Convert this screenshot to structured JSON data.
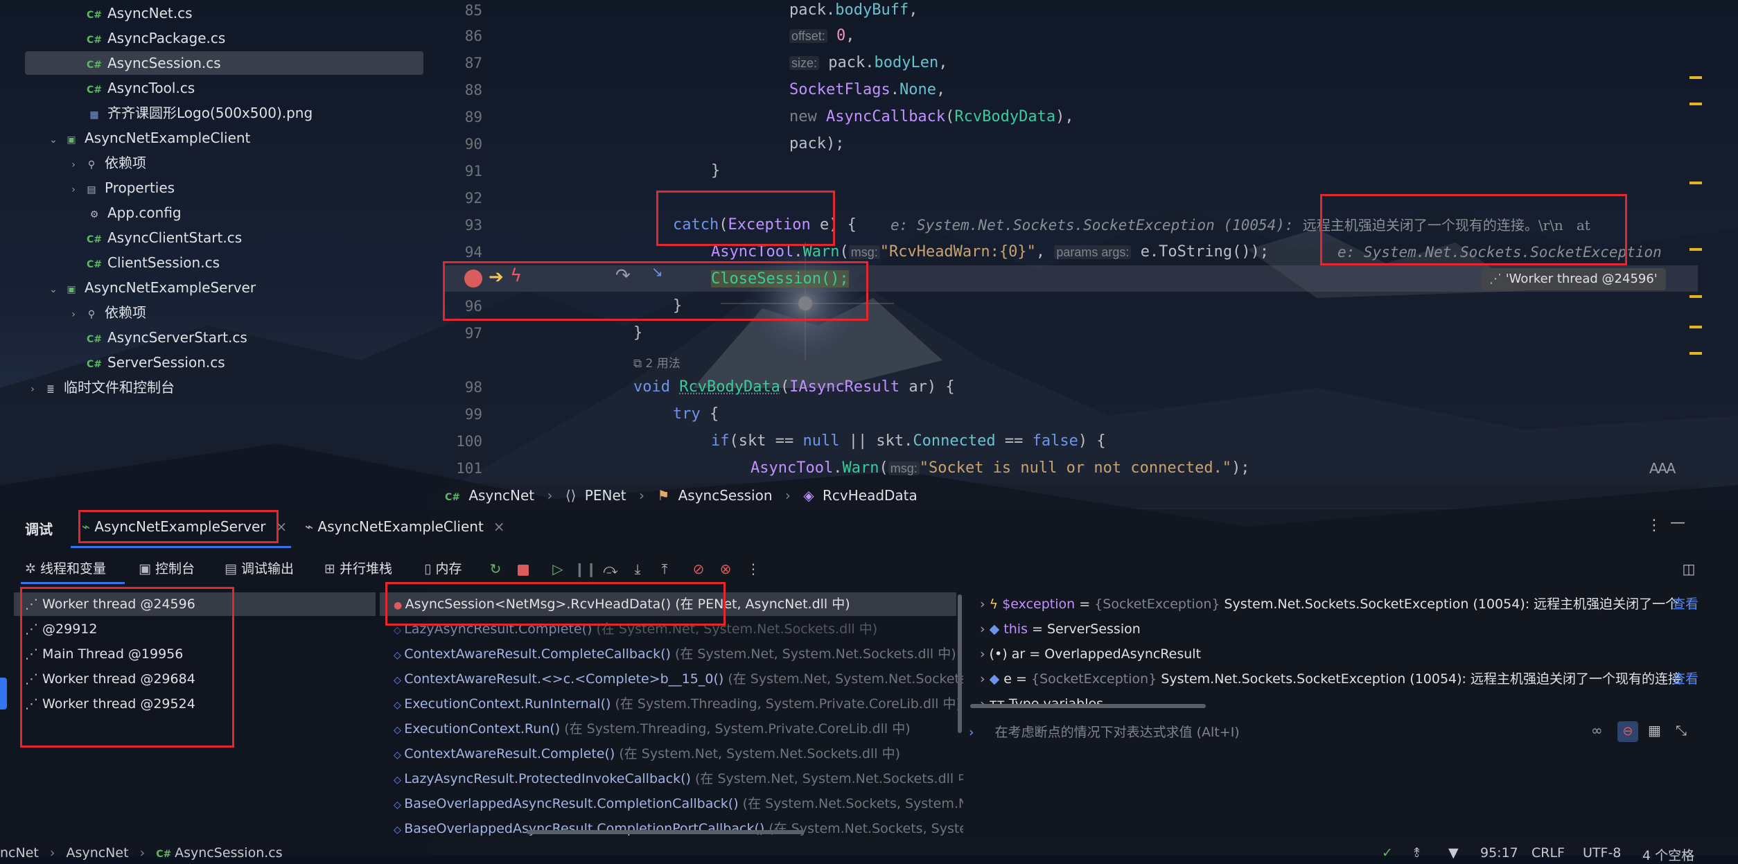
{
  "tree": {
    "items": [
      {
        "label": "AsyncNet.cs",
        "icon": "csharp-file-icon"
      },
      {
        "label": "AsyncPackage.cs",
        "icon": "csharp-file-icon"
      },
      {
        "label": "AsyncSession.cs",
        "icon": "csharp-file-icon"
      },
      {
        "label": "AsyncTool.cs",
        "icon": "csharp-file-icon"
      },
      {
        "label": "齐齐课圆形Logo(500x500).png",
        "icon": "image-file-icon"
      },
      {
        "label": "AsyncNetExampleClient",
        "icon": "csharp-project-icon"
      },
      {
        "label": "依赖项",
        "icon": "dependencies-icon"
      },
      {
        "label": "Properties",
        "icon": "properties-folder-icon"
      },
      {
        "label": "App.config",
        "icon": "config-file-icon"
      },
      {
        "label": "AsyncClientStart.cs",
        "icon": "csharp-file-icon"
      },
      {
        "label": "ClientSession.cs",
        "icon": "csharp-file-icon"
      },
      {
        "label": "AsyncNetExampleServer",
        "icon": "csharp-project-icon"
      },
      {
        "label": "依赖项",
        "icon": "dependencies-icon"
      },
      {
        "label": "AsyncServerStart.cs",
        "icon": "csharp-file-icon"
      },
      {
        "label": "ServerSession.cs",
        "icon": "csharp-file-icon"
      },
      {
        "label": "临时文件和控制台",
        "icon": "scratches-icon"
      }
    ],
    "cs_badge": "C#"
  },
  "editor": {
    "line_numbers": [
      "85",
      "86",
      "87",
      "88",
      "89",
      "90",
      "91",
      "92",
      "93",
      "94",
      "95",
      "96",
      "97",
      "98",
      "99",
      "100",
      "101"
    ],
    "lines": {
      "l85_obj": "pack.",
      "l85_prop": "bodyBuff",
      "l85_end": ",",
      "l86_hint": "offset:",
      "l86_val": "0",
      "l86_end": ",",
      "l87_hint": "size:",
      "l87_obj": "pack.",
      "l87_prop": "bodyLen",
      "l87_end": ",",
      "l88_type": "SocketFlags",
      "l88_dot": ".",
      "l88_enum": "None",
      "l88_end": ",",
      "l89_new": "new ",
      "l89_type": "AsyncCallback",
      "l89_open": "(",
      "l89_fn": "RcvBodyData",
      "l89_end": "),",
      "l90": "pack);",
      "l91": "}",
      "l93_kw": "catch",
      "l93_open": "(",
      "l93_type": "Exception",
      "l93_var": " e) {",
      "l93_inline": "e: System.Net.Sockets.SocketException (10054):",
      "l93_inline2": "远程主机强迫关闭了一个现有的连接。\\r\\n   at",
      "l94_cls": "AsyncTool",
      "l94_dot": ".",
      "l94_meth": "Warn",
      "l94_open": "(",
      "l94_hint1": "msg:",
      "l94_str": "\"RcvHeadWarn:{0}\"",
      "l94_comma": ", ",
      "l94_hint2": "params args:",
      "l94_rest": "e.ToString());",
      "l94_inline": "e: System.Net.Sockets.SocketException",
      "l95": "CloseSession();",
      "l96": "}",
      "l97": "}",
      "usages": "2 用法",
      "l98_kw": "void ",
      "l98_fn": "RcvBodyData",
      "l98_open": "(",
      "l98_type": "IAsyncResult",
      "l98_rest": " ar) {",
      "l99_kw": "try",
      "l99_rest": " {",
      "l100_kw": "if",
      "l100_a": "(skt == ",
      "l100_null": "null",
      "l100_b": " || skt.",
      "l100_prop": "Connected",
      "l100_c": " == ",
      "l100_false": "false",
      "l100_d": ") {",
      "l101_cls": "AsyncTool",
      "l101_dot": ".",
      "l101_meth": "Warn",
      "l101_open": "(",
      "l101_hint": "msg:",
      "l101_str": "\"Socket is null or not connected.\"",
      "l101_end": ");"
    },
    "thread_tooltip": "'Worker thread @24596'",
    "breadcrumb": [
      "AsyncNet",
      "PENet",
      "AsyncSession",
      "RcvHeadData"
    ],
    "font_size_icon": "AAA"
  },
  "debug": {
    "title": "调试",
    "tabs": [
      "AsyncNetExampleServer",
      "AsyncNetExampleClient"
    ],
    "subtabs": [
      "线程和变量",
      "控制台",
      "调试输出",
      "并行堆栈",
      "内存"
    ],
    "threads": [
      "Worker thread @24596",
      "@29912",
      "Main Thread @19956",
      "Worker thread @29684",
      "Worker thread @29524"
    ],
    "frames": [
      {
        "method": "AsyncSession<NetMsg>.RcvHeadData()",
        "loc": "(在 PENet, AsyncNet.dll 中)",
        "active": true
      },
      {
        "method": "LazyAsyncResult.Complete()",
        "loc": "(在 System.Net, System.Net.Sockets.dll 中)"
      },
      {
        "method": "ContextAwareResult.CompleteCallback()",
        "loc": "(在 System.Net, System.Net.Sockets.dll 中)"
      },
      {
        "method": "ContextAwareResult.<>c.<Complete>b__15_0()",
        "loc": "(在 System.Net, System.Net.Sockets.dll"
      },
      {
        "method": "ExecutionContext.RunInternal()",
        "loc": "(在 System.Threading, System.Private.CoreLib.dll 中)"
      },
      {
        "method": "ExecutionContext.Run()",
        "loc": "(在 System.Threading, System.Private.CoreLib.dll 中)"
      },
      {
        "method": "ContextAwareResult.Complete()",
        "loc": "(在 System.Net, System.Net.Sockets.dll 中)"
      },
      {
        "method": "LazyAsyncResult.ProtectedInvokeCallback()",
        "loc": "(在 System.Net, System.Net.Sockets.dll 中)"
      },
      {
        "method": "BaseOverlappedAsyncResult.CompletionCallback()",
        "loc": "(在 System.Net.Sockets, System.N"
      },
      {
        "method": "BaseOverlappedAsyncResult.CompletionPortCallback()",
        "loc": "(在 System.Net.Sockets, Syste"
      }
    ],
    "variables": [
      {
        "name": "$exception",
        "eq": " = ",
        "type": "{SocketException}",
        "value": "System.Net.Sockets.SocketException (10054): 远程主机强迫关闭了一个",
        "link": "查看",
        "icon": "exception-icon"
      },
      {
        "name": "this",
        "eq": " = ",
        "type": "",
        "value": "ServerSession",
        "link": "",
        "icon": "field-icon"
      },
      {
        "name": "ar",
        "eq": " = ",
        "type": "",
        "value": "OverlappedAsyncResult",
        "link": "",
        "icon": "parameter-icon"
      },
      {
        "name": "e",
        "eq": " = ",
        "type": "{SocketException}",
        "value": "System.Net.Sockets.SocketException (10054): 远程主机强迫关闭了一个现有的连接",
        "link": "查看",
        "icon": "field-icon"
      },
      {
        "name": "Type variables",
        "eq": "",
        "type": "",
        "value": "",
        "link": "",
        "icon": "type-variables-icon"
      }
    ],
    "eval_placeholder": "在考虑断点的情况下对表达式求值 (Alt+I)"
  },
  "statusbar": {
    "breadcrumb": [
      "ncNet",
      "AsyncNet",
      "AsyncSession.cs"
    ],
    "position": "95:17",
    "line_sep": "CRLF",
    "encoding": "UTF-8",
    "indent": "4 个空格"
  },
  "colors": {
    "accent": "#3574f0",
    "highlight_box": "#e0282e",
    "keyword": "#6c95eb",
    "method": "#39cc9b"
  }
}
